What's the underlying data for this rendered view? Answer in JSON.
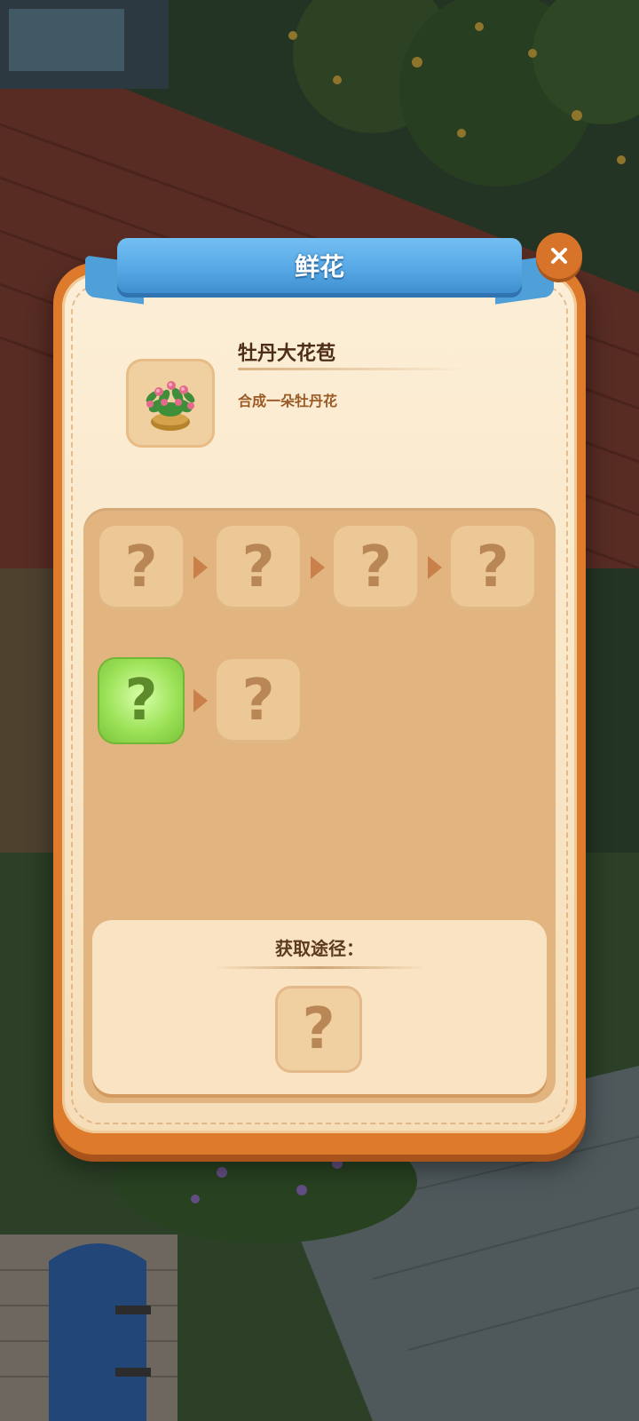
{
  "dialog": {
    "title": "鲜花",
    "close_icon": "close-icon"
  },
  "item": {
    "icon": "peony-bush-icon",
    "name": "牡丹大花苞",
    "description": "合成一朵牡丹花"
  },
  "chain": {
    "row1": [
      "?",
      "?",
      "?",
      "?"
    ],
    "row2": [
      "?",
      "?"
    ],
    "active_slot": "row2-1",
    "arrow_icon": "chevron-right-icon"
  },
  "source": {
    "title": "获取途径：",
    "slot": "?"
  },
  "colors": {
    "ribbon": "#58a9e6",
    "frame": "#de7a2c",
    "panel": "#e1b480",
    "active_slot": "#9ee35a"
  }
}
